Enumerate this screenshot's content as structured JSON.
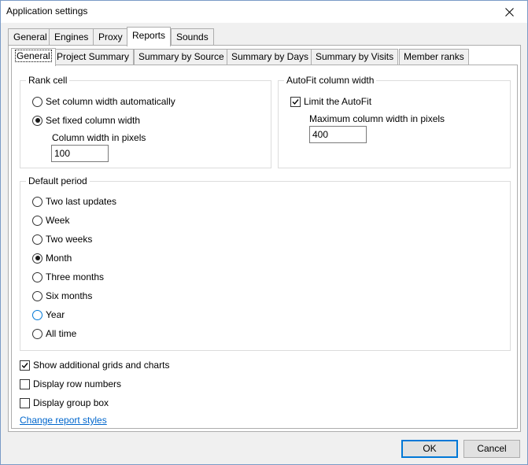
{
  "window": {
    "title": "Application settings"
  },
  "main_tabs": [
    {
      "label": "General"
    },
    {
      "label": "Engines"
    },
    {
      "label": "Proxy"
    },
    {
      "label": "Reports"
    },
    {
      "label": "Sounds"
    }
  ],
  "sub_tabs": [
    {
      "label": "General"
    },
    {
      "label": "Project Summary"
    },
    {
      "label": "Summary by Source"
    },
    {
      "label": "Summary by Days"
    },
    {
      "label": "Summary by Visits"
    },
    {
      "label": "Member ranks"
    }
  ],
  "rank_cell": {
    "title": "Rank cell",
    "auto_label": "Set column width automatically",
    "fixed_label": "Set fixed column width",
    "width_label": "Column width in pixels",
    "width_value": "100",
    "selected": "fixed"
  },
  "autofit": {
    "title": "AutoFit column width",
    "limit_label": "Limit the AutoFit",
    "limit_checked": true,
    "max_label": "Maximum column width in pixels",
    "max_value": "400"
  },
  "default_period": {
    "title": "Default period",
    "options": [
      {
        "label": "Two last updates"
      },
      {
        "label": "Week"
      },
      {
        "label": "Two weeks"
      },
      {
        "label": "Month"
      },
      {
        "label": "Three months"
      },
      {
        "label": "Six months"
      },
      {
        "label": "Year"
      },
      {
        "label": "All time"
      }
    ],
    "selected": "Month"
  },
  "options": {
    "show_grids_label": "Show additional grids and charts",
    "show_grids_checked": true,
    "row_numbers_label": "Display row numbers",
    "row_numbers_checked": false,
    "group_box_label": "Display group box",
    "group_box_checked": false
  },
  "change_styles_link": "Change report styles",
  "buttons": {
    "ok": "OK",
    "cancel": "Cancel"
  },
  "colors": {
    "accent": "#0078d7",
    "link": "#0066cc"
  }
}
